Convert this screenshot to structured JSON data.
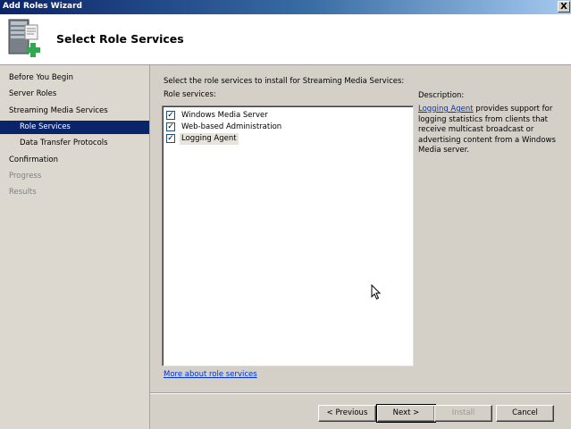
{
  "window": {
    "title": "Add Roles Wizard",
    "close_label": "X"
  },
  "header": {
    "title": "Select Role Services",
    "icon": "server-role-add-icon"
  },
  "nav": {
    "items": [
      {
        "label": "Before You Begin",
        "state": "normal"
      },
      {
        "label": "Server Roles",
        "state": "normal"
      },
      {
        "label": "Streaming Media Services",
        "state": "normal"
      },
      {
        "label": "Role Services",
        "state": "selected"
      },
      {
        "label": "Data Transfer Protocols",
        "state": "normal"
      },
      {
        "label": "Confirmation",
        "state": "normal"
      },
      {
        "label": "Progress",
        "state": "disabled"
      },
      {
        "label": "Results",
        "state": "disabled"
      }
    ]
  },
  "main": {
    "instruction": "Select the role services to install for Streaming Media Services:",
    "role_services_label": "Role services:",
    "role_services": [
      {
        "label": "Windows Media Server",
        "checked": true
      },
      {
        "label": "Web-based Administration",
        "checked": true
      },
      {
        "label": "Logging Agent",
        "checked": true
      }
    ],
    "description_label": "Description:",
    "description_link": "Logging Agent",
    "description_text": " provides support for logging statistics from clients that receive multicast broadcast or advertising content from a Windows Media server.",
    "more_link": "More about role services"
  },
  "buttons": {
    "previous": "< Previous",
    "next": "Next >",
    "install": "Install",
    "cancel": "Cancel"
  },
  "colors": {
    "selection": "#0a246a",
    "link": "#0033cc"
  }
}
